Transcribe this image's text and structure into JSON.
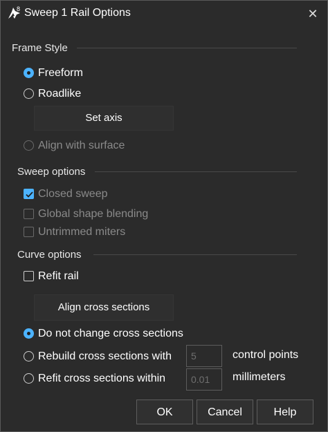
{
  "window": {
    "title": "Sweep 1 Rail Options",
    "app_badge": "8",
    "close_glyph": "✕"
  },
  "frame_style": {
    "label": "Frame Style",
    "freeform": {
      "label": "Freeform",
      "selected": true
    },
    "roadlike": {
      "label": "Roadlike",
      "selected": false
    },
    "set_axis_button": "Set axis",
    "align_with_surface": {
      "label": "Align with surface",
      "selected": false,
      "enabled": false
    }
  },
  "sweep_options": {
    "label": "Sweep options",
    "closed_sweep": {
      "label": "Closed sweep",
      "checked": true,
      "enabled": false
    },
    "global_shape_blending": {
      "label": "Global shape blending",
      "checked": false,
      "enabled": false
    },
    "untrimmed_miters": {
      "label": "Untrimmed miters",
      "checked": false,
      "enabled": false
    }
  },
  "curve_options": {
    "label": "Curve options",
    "refit_rail": {
      "label": "Refit rail",
      "checked": false
    },
    "align_cross_sections_button": "Align cross sections",
    "do_not_change": {
      "label": "Do not change cross sections",
      "selected": true
    },
    "rebuild": {
      "label": "Rebuild cross sections with",
      "selected": false,
      "value": "5",
      "unit": "control points"
    },
    "refit": {
      "label": "Refit cross sections within",
      "selected": false,
      "value": "0.01",
      "unit": "millimeters"
    }
  },
  "buttons": {
    "ok": "OK",
    "cancel": "Cancel",
    "help": "Help"
  },
  "colors": {
    "accent": "#4cb3ff",
    "background": "#2b2b2b",
    "disabled_text": "#8a8a8a"
  }
}
